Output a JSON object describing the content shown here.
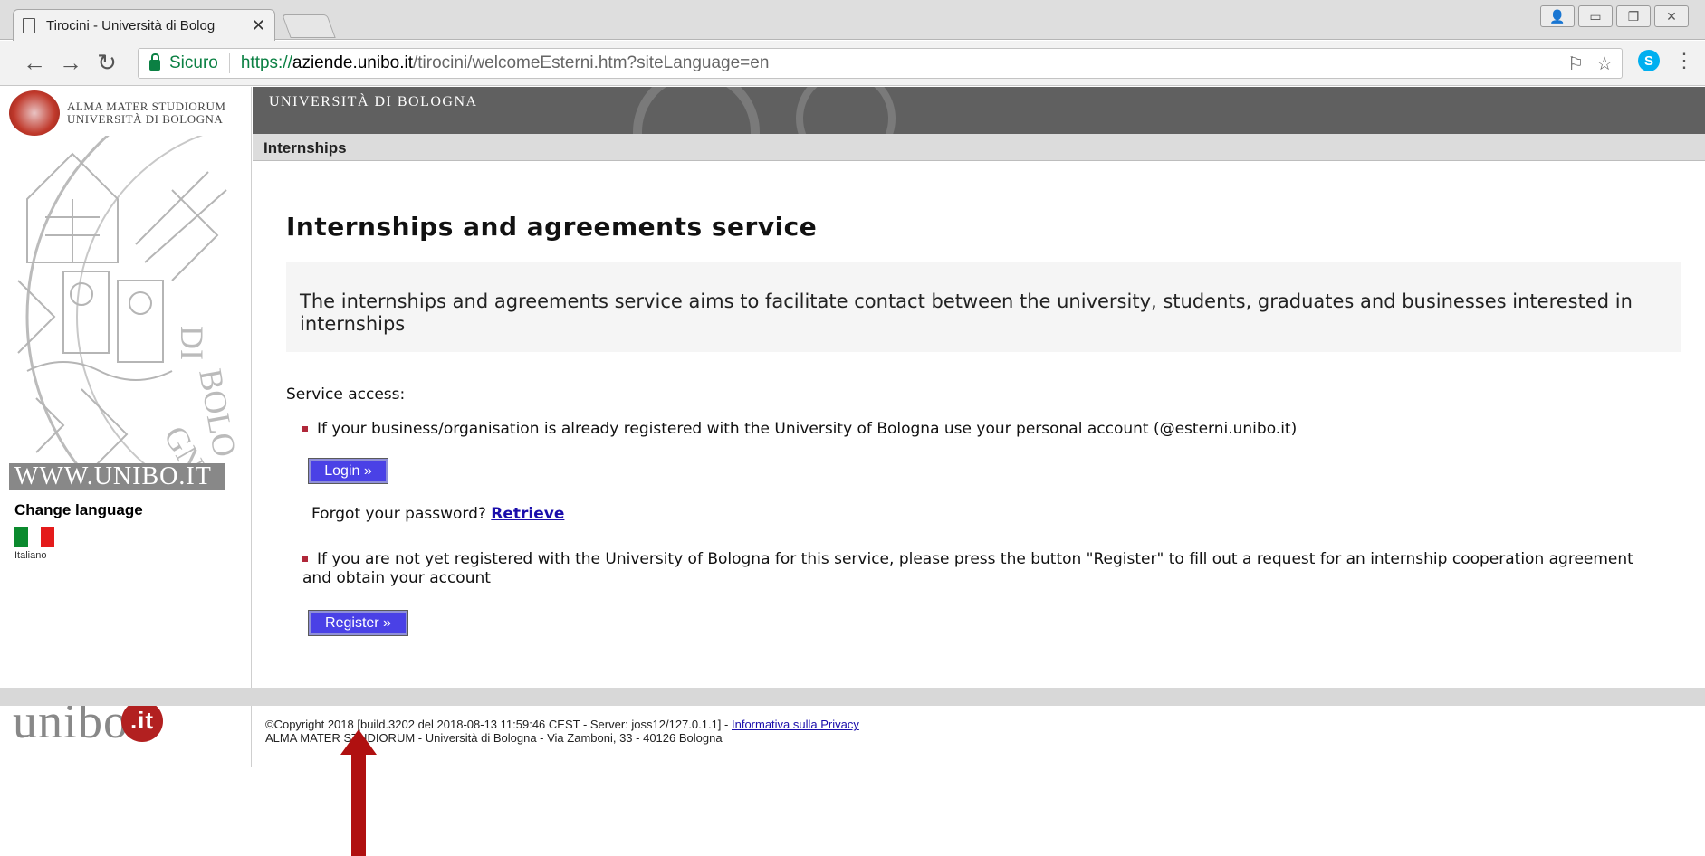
{
  "browser": {
    "tab_title": "Tirocini - Università di Bolog",
    "secure_label": "Sicuro",
    "url_scheme": "https://",
    "url_host": "aziende.unibo.it",
    "url_path": "/tirocini/welcomeEsterni.htm?siteLanguage=en"
  },
  "sidebar": {
    "logo_line1": "ALMA MATER STUDIORUM",
    "logo_line2": "UNIVERSITÀ DI BOLOGNA",
    "www": "WWW.UNIBO.IT",
    "change_language": "Change language",
    "language_label": "Italiano"
  },
  "header": {
    "university": "UNIVERSITÀ DI BOLOGNA",
    "section": "Internships"
  },
  "main": {
    "title": "Internships and agreements service",
    "intro": "The internships and agreements service aims to facilitate contact between the university, students, graduates and businesses interested in internships",
    "service_access": "Service access:",
    "registered_text": "If your business/organisation is already registered with the University of Bologna use your personal account (@esterni.unibo.it)",
    "login_button": "Login »",
    "forgot_text": "Forgot your password?",
    "retrieve_link": "Retrieve",
    "unregistered_text": "If you are not yet registered with the University of Bologna for this service, please press the button \"Register\" to fill out a request for an internship cooperation agreement and obtain your account",
    "register_button": "Register »"
  },
  "footer": {
    "logo": "unibo",
    "logo_it": ".it",
    "copyright": "©Copyright 2018 [build.3202 del 2018-08-13 11:59:46 CEST - Server: joss12/127.0.1.1] - ",
    "privacy_link": "Informativa sulla Privacy",
    "address": "ALMA MATER STUDIORUM - Università di Bologna - Via Zamboni, 33 - 40126 Bologna"
  },
  "colors": {
    "button": "#4a41e6",
    "header_bar": "#606060",
    "annotation_arrow": "#b01010"
  }
}
